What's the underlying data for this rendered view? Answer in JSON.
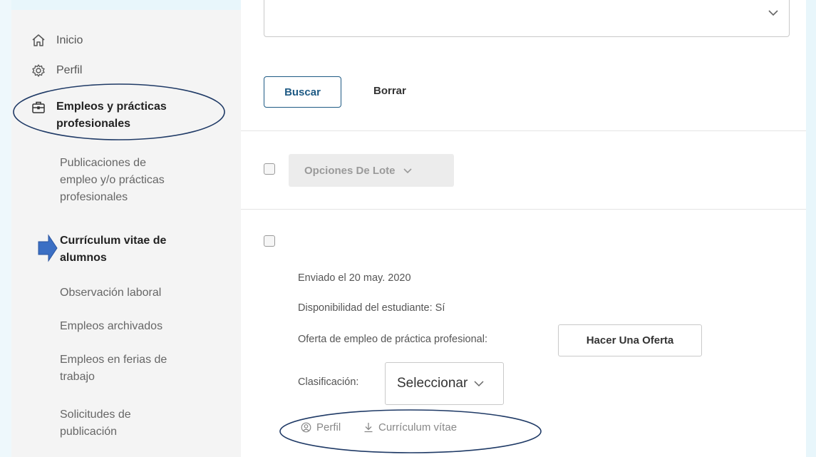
{
  "sidebar": {
    "items": [
      {
        "label": "Inicio",
        "icon": "home-icon"
      },
      {
        "label": "Perfil",
        "icon": "gear-icon"
      },
      {
        "label_line1": "Empleos y prácticas",
        "label_line2": "profesionales",
        "icon": "briefcase-icon"
      }
    ],
    "sub_items": [
      {
        "lines": [
          "Publicaciones de",
          "empleo y/o prácticas",
          "profesionales"
        ]
      },
      {
        "lines": [
          "Currículum vitae de",
          "alumnos"
        ]
      },
      {
        "lines": [
          "Observación laboral"
        ]
      },
      {
        "lines": [
          "Empleos archivados"
        ]
      },
      {
        "lines": [
          "Empleos en ferias de",
          "trabajo"
        ]
      },
      {
        "lines": [
          "Solicitudes de",
          "publicación"
        ]
      }
    ]
  },
  "filters": {
    "search_label": "Buscar",
    "clear_label": "Borrar"
  },
  "batch": {
    "label": "Opciones De Lote"
  },
  "record": {
    "sent": "Enviado el 20 may. 2020",
    "availability": "Disponibilidad del estudiante: Sí",
    "offer_label": "Oferta de empleo de práctica profesional:",
    "offer_button": "Hacer Una Oferta",
    "rank_label": "Clasificación:",
    "rank_value": "Seleccionar",
    "profile_link": "Perfil",
    "cv_link": "Currículum vítae"
  },
  "colors": {
    "annotation": "#1f3a66",
    "arrow": "#3b6fc4",
    "primary": "#1e5a84",
    "sidebar_bg": "#f4f4f4"
  }
}
